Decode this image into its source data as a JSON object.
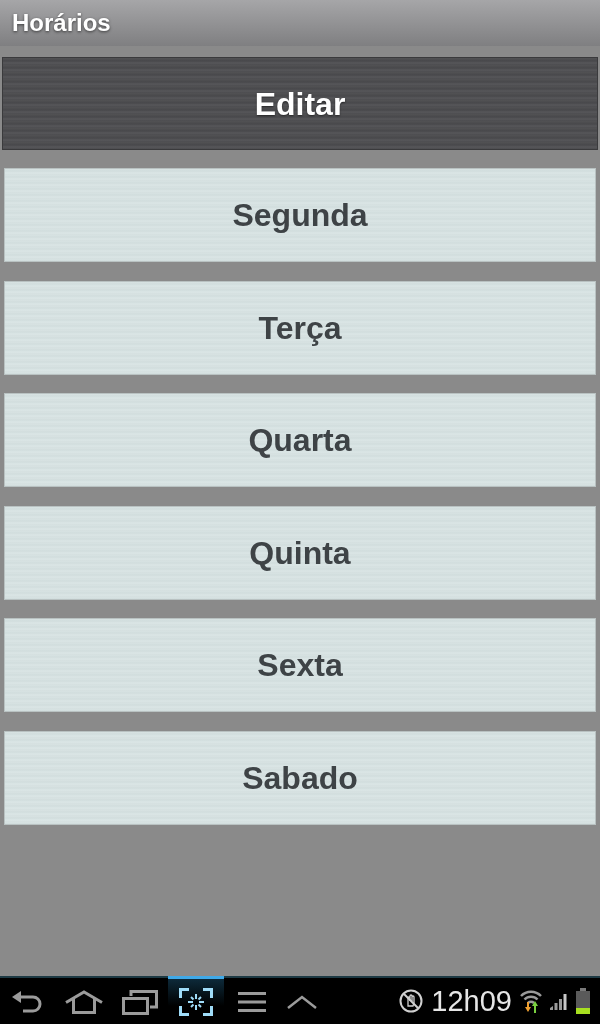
{
  "title_bar": {
    "title": "Horários"
  },
  "edit_button": {
    "label": "Editar"
  },
  "days": [
    {
      "label": "Segunda"
    },
    {
      "label": "Terça"
    },
    {
      "label": "Quarta"
    },
    {
      "label": "Quinta"
    },
    {
      "label": "Sexta"
    },
    {
      "label": "Sabado"
    }
  ],
  "nav_bar": {
    "buttons": [
      {
        "selected": false
      },
      {
        "selected": false
      },
      {
        "selected": false
      },
      {
        "selected": true
      },
      {
        "selected": false
      },
      {
        "selected": false
      }
    ]
  },
  "status": {
    "time": "12h09"
  }
}
